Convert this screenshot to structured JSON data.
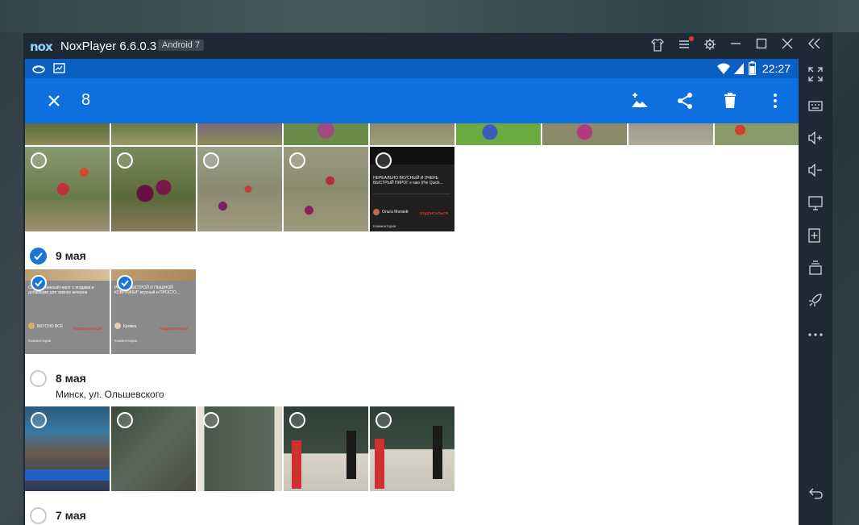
{
  "window": {
    "logo": "nox",
    "title": "NoxPlayer 6.6.0.3",
    "badge": "Android 7",
    "controls": [
      "shirt-icon",
      "menu-icon",
      "gear-icon",
      "minimize-icon",
      "maximize-icon",
      "close-icon",
      "collapse-icon"
    ]
  },
  "statusbar": {
    "time": "22:27",
    "icons": [
      "cloud-icon",
      "gallery-icon",
      "wifi-icon",
      "signal-icon",
      "battery-icon"
    ]
  },
  "appbar": {
    "selected_count": "8",
    "actions": [
      "add-photo-icon",
      "share-icon",
      "delete-icon",
      "more-icon"
    ]
  },
  "sections": [
    {
      "date": "9 мая",
      "checked": true
    },
    {
      "date": "8 мая",
      "location": "Минск, ул. Ольшевского",
      "checked": false
    },
    {
      "date": "7 мая",
      "checked": false
    }
  ],
  "screens": {
    "dark": {
      "channel": "Ольга Матвей",
      "title": "НЕРЕАЛЬНО ВКУСНЫЙ И ОЧЕНЬ БЫСТРЫЙ ПИРОГ к чаю (Pie Quick...",
      "subscribe": "ПОДПИСАТЬСЯ",
      "comments": "Комментарии"
    },
    "left": {
      "title": "Сочный, нежный пирог с ягодами и добавками для зимних вечеров",
      "channel": "ВКУСНО ВСЁ",
      "subscribe": "ПОДПИСАТЬСЯ",
      "comments": "Комментарии"
    },
    "right": {
      "title": "Рецепт БЫСТРОЙ И ПЫШНОЙ КОВРИЖКИ* вкусный и ПРОСТО...",
      "channel": "Кровка",
      "subscribe": "ПОДПИСАТЬСЯ",
      "comments": "Комментарии"
    }
  },
  "colors": {
    "accent": "#0e6fe0",
    "statusbar": "#0b5fc2",
    "check": "#1976d2",
    "window": "#1d2935"
  }
}
